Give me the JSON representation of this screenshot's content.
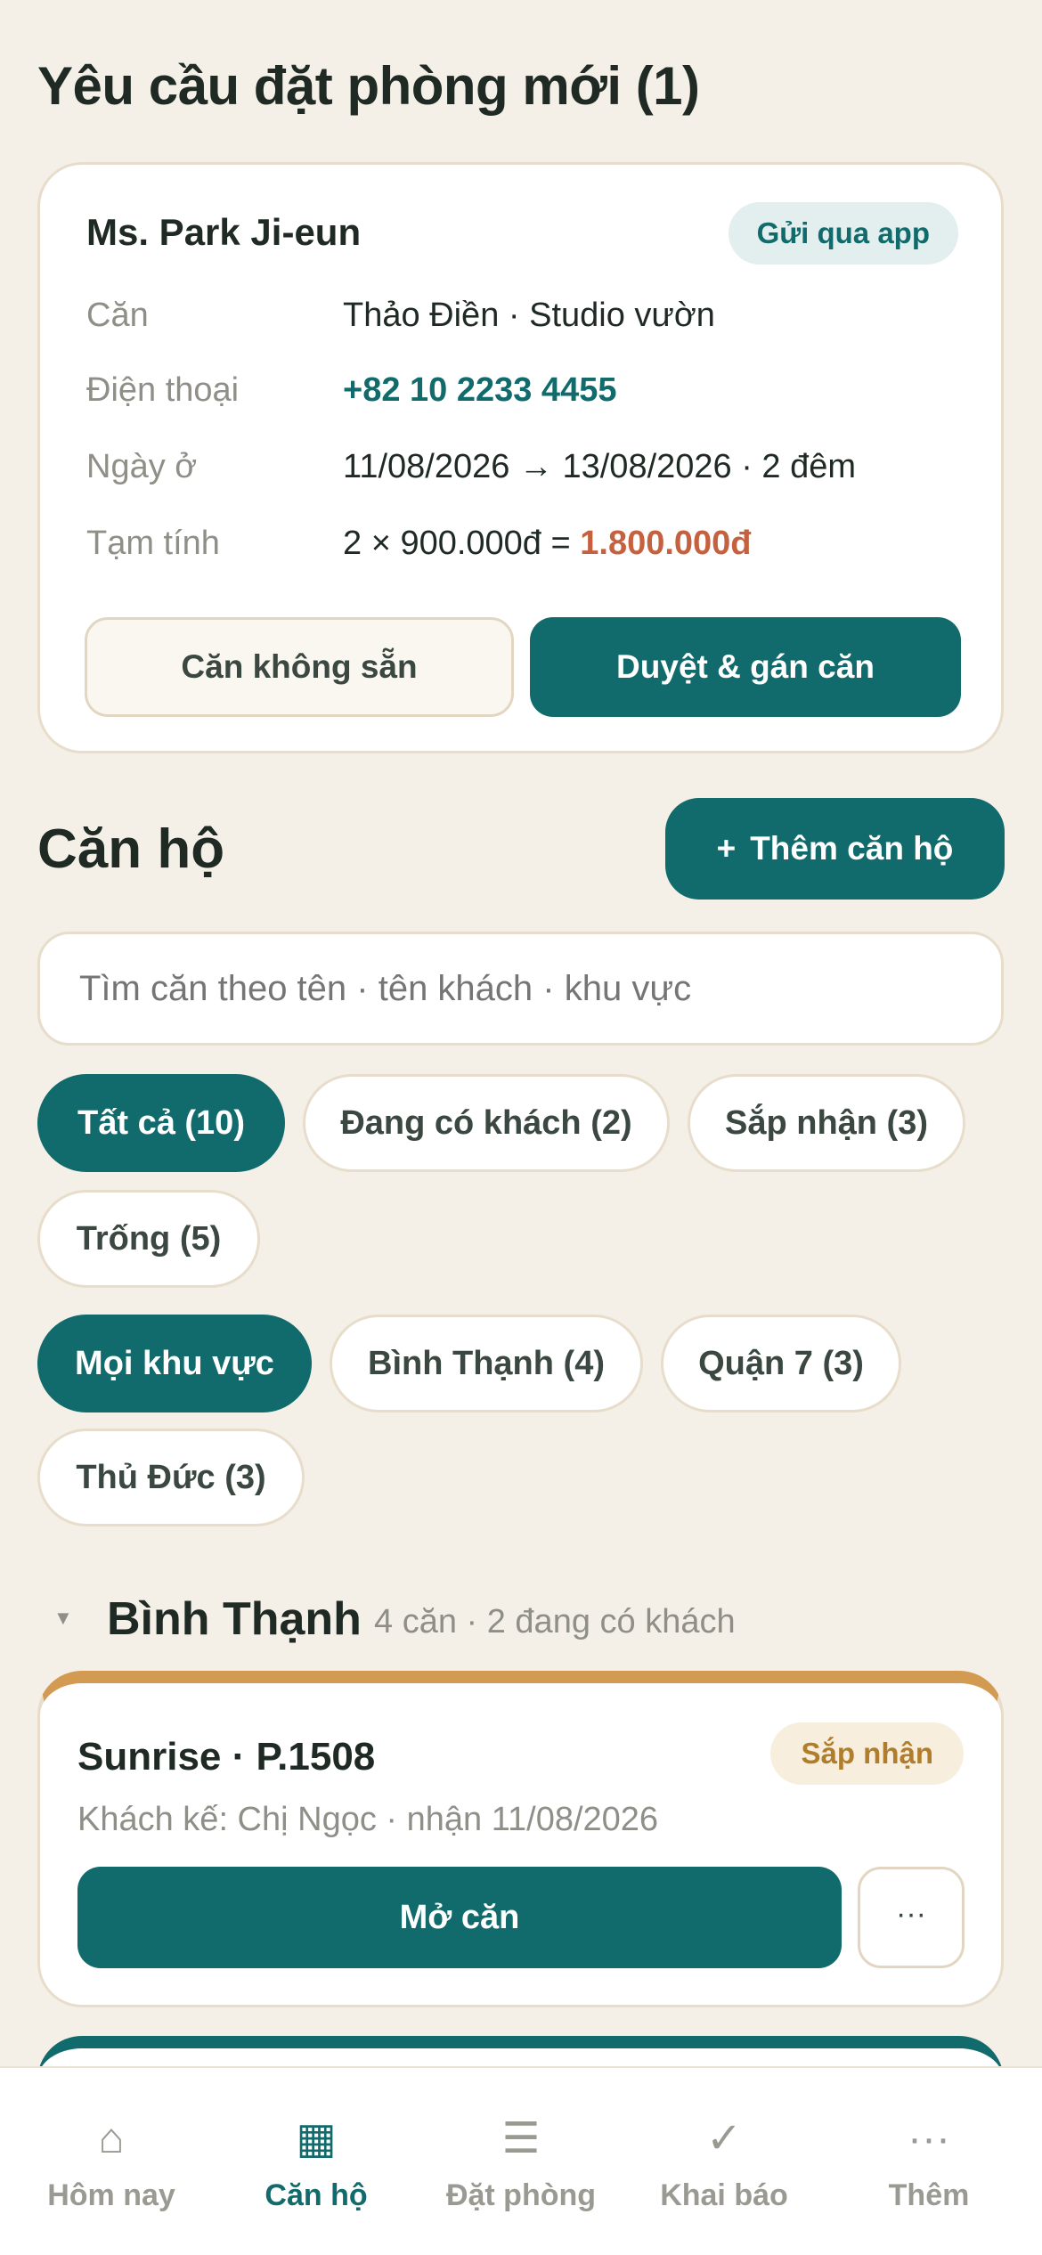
{
  "request_section": {
    "title": "Yêu cầu đặt phòng mới (1)",
    "card": {
      "guest_name": "Ms. Park Ji-eun",
      "source_badge": "Gửi qua app",
      "rows": [
        {
          "label": "Căn",
          "value": "Thảo Điền · Studio vườn"
        },
        {
          "label": "Điện thoại",
          "value": "+82 10 2233 4455"
        },
        {
          "label": "Ngày ở",
          "value": "11/08/2026 → 13/08/2026 · 2 đêm"
        },
        {
          "label": "Tạm tính",
          "value": "2 × 900.000đ = ",
          "total": "1.800.000đ"
        }
      ],
      "reject_label": "Căn không sẵn",
      "approve_label": "Duyệt & gán căn"
    }
  },
  "units_section": {
    "title": "Căn hộ",
    "add_button": {
      "icon": "plus-icon",
      "label": "Thêm căn hộ",
      "glyph": "+"
    },
    "search_placeholder": "Tìm căn theo tên · tên khách · khu vực",
    "status_filters": [
      {
        "label": "Tất cả (10)",
        "active": true
      },
      {
        "label": "Đang có khách (2)",
        "active": false
      },
      {
        "label": "Sắp nhận (3)",
        "active": false
      },
      {
        "label": "Trống (5)",
        "active": false
      }
    ],
    "area_filters": [
      {
        "label": "Mọi khu vực",
        "active": true
      },
      {
        "label": "Bình Thạnh (4)",
        "active": false
      },
      {
        "label": "Quận 7 (3)",
        "active": false
      },
      {
        "label": "Thủ Đức (3)",
        "active": false
      }
    ],
    "group": {
      "caret": "▼",
      "title": "Bình Thạnh",
      "subtitle": "4 căn · 2 đang có khách"
    },
    "unit_card": {
      "name": "Sunrise · P.1508",
      "status_badge": "Sắp nhận",
      "status_color": "#D39B52",
      "subtitle": "Khách kế: Chị Ngọc · nhận 11/08/2026",
      "open_label": "Mở căn",
      "more_label": "···"
    }
  },
  "colors": {
    "background": "#F4EFE7",
    "primary": "#116A6B",
    "price": "#C5613F",
    "upcoming": "#D39B52"
  },
  "tabbar": [
    {
      "icon": "home-icon",
      "glyph": "⌂",
      "label": "Hôm nay",
      "active": false
    },
    {
      "icon": "grid-icon",
      "glyph": "▦",
      "label": "Căn hộ",
      "active": true
    },
    {
      "icon": "list-icon",
      "glyph": "☰",
      "label": "Đặt phòng",
      "active": false
    },
    {
      "icon": "check-icon",
      "glyph": "✓",
      "label": "Khai báo",
      "active": false
    },
    {
      "icon": "more-icon",
      "glyph": "···",
      "label": "Thêm",
      "active": false
    }
  ]
}
